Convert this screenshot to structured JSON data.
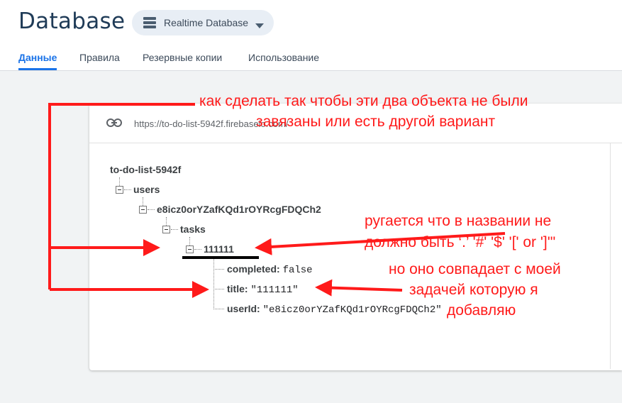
{
  "header": {
    "title": "Database",
    "db_selector": {
      "label": "Realtime Database",
      "icon": "database-icon"
    }
  },
  "tabs": [
    {
      "label": "Данные",
      "active": true
    },
    {
      "label": "Правила",
      "active": false
    },
    {
      "label": "Резервные копии",
      "active": false
    },
    {
      "label": "Использование",
      "active": false
    }
  ],
  "data_panel": {
    "url": "https://to-do-list-5942f.firebaseio.com/",
    "tree": {
      "root": "to-do-list-5942f",
      "users": "users",
      "uid": "e8icz0orYZafKQd1rOYRcgFDQCh2",
      "tasks": "tasks",
      "task_key": "111111",
      "fields": [
        {
          "key": "completed:",
          "value": "false"
        },
        {
          "key": "title:",
          "value": "\"111111\""
        },
        {
          "key": "userId:",
          "value": "\"e8icz0orYZafKQd1rOYRcgFDQCh2\""
        }
      ]
    }
  },
  "annotations": {
    "top_line1": "как сделать так чтобы эти два объекта не были",
    "top_line2": "завязаны или есть другой вариант",
    "right_line1": "ругается что в названии не",
    "right_line2": "должно быть ‘.’ '#' '$' '[' or ']'\"",
    "bottom_line1": "но оно совпадает с моей",
    "bottom_line2": "задачей которую я",
    "bottom_line3": "добавляю",
    "color": "#ff1a1a"
  }
}
